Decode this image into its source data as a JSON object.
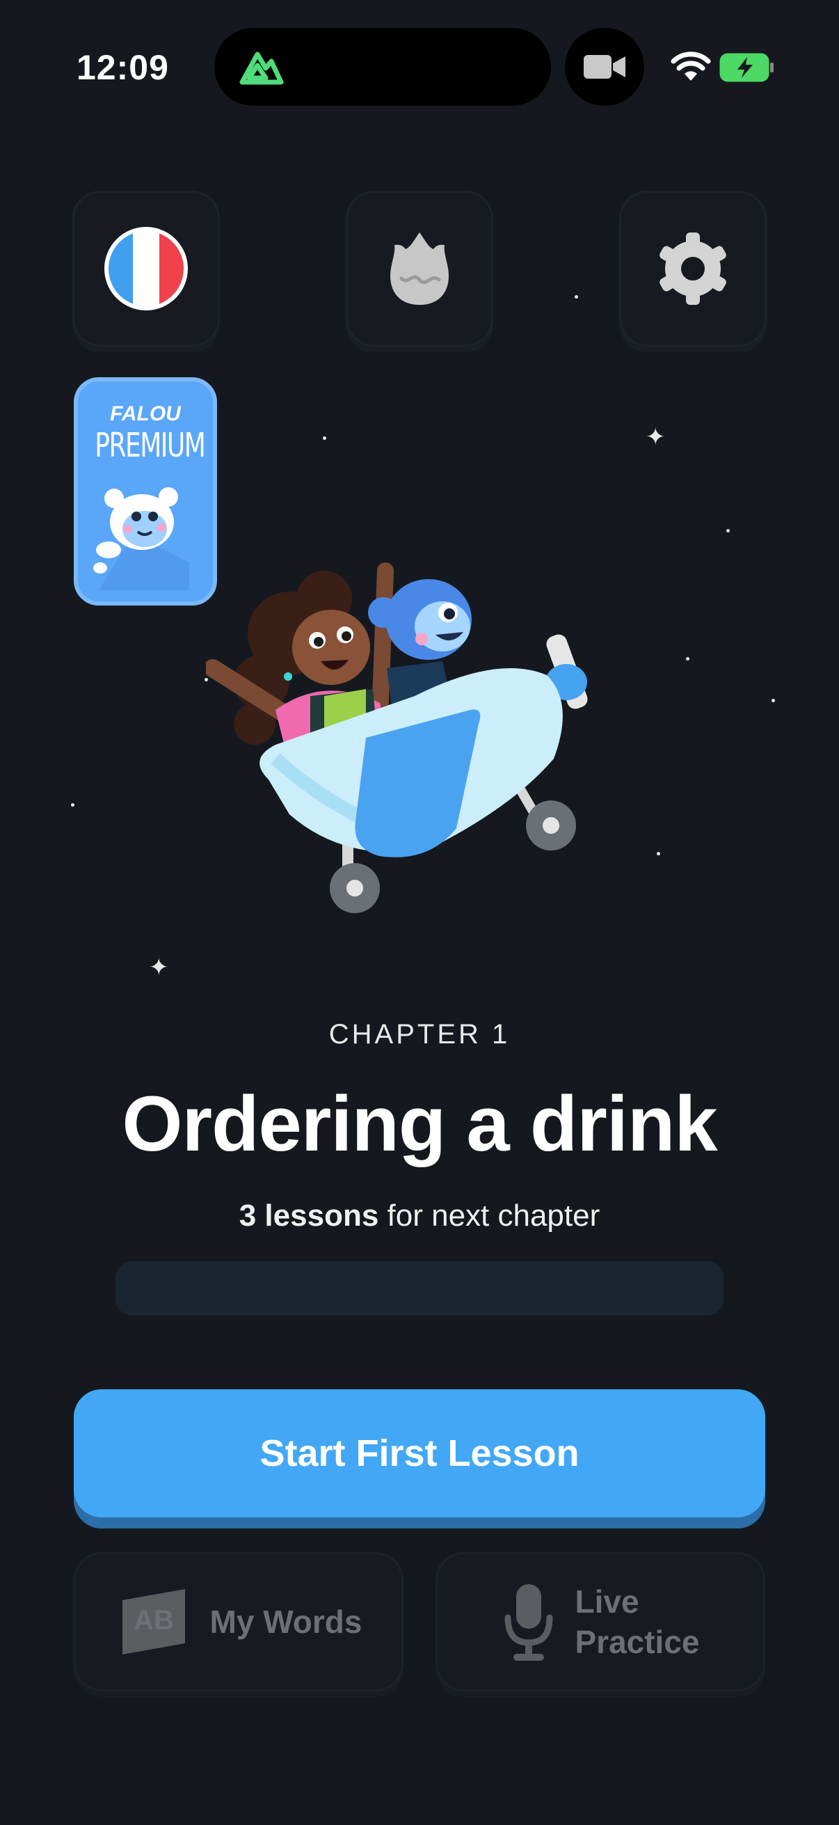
{
  "status_bar": {
    "time": "12:09"
  },
  "premium_card": {
    "brand": "FALOU",
    "title": "PREMIUM"
  },
  "chapter": {
    "label": "CHAPTER 1",
    "title": "Ordering a drink",
    "lessons_count": "3 lessons",
    "lessons_suffix": " for next chapter",
    "progress": 0
  },
  "actions": {
    "start_label": "Start First Lesson",
    "my_words_label": "My Words",
    "flashcard_text": "AB",
    "live_practice_line1": "Live",
    "live_practice_line2": "Practice"
  },
  "colors": {
    "background": "#15191f",
    "accent": "#42a8f5",
    "premium": "#5aa6f8",
    "muted_text": "#6d6f73"
  },
  "icons": [
    "mountain-app-icon",
    "camera-icon",
    "wifi-icon",
    "battery-charging-icon",
    "french-flag-icon",
    "dragon-egg-icon",
    "gear-icon",
    "bear-mascot-icon",
    "flashcard-icon",
    "microphone-icon"
  ]
}
